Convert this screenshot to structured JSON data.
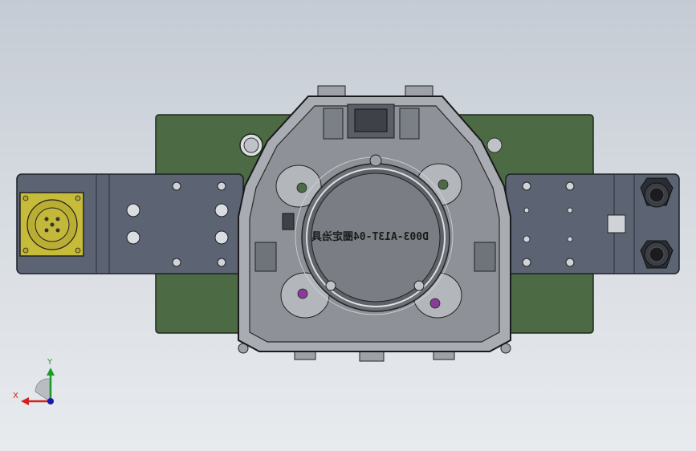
{
  "part_engraving": "D003-A13T-04圈定治具",
  "triad": {
    "x_label": "X",
    "y_label": "Y",
    "x_color": "#d42020",
    "y_color": "#1c9a2a",
    "z_color": "#1a1aa8"
  },
  "colors": {
    "base_plate": "#4c6a44",
    "side_plate": "#5c6474",
    "connector_body": "#c7bb3a",
    "housing": "#a9acb2",
    "marker": "#8a3a98"
  }
}
